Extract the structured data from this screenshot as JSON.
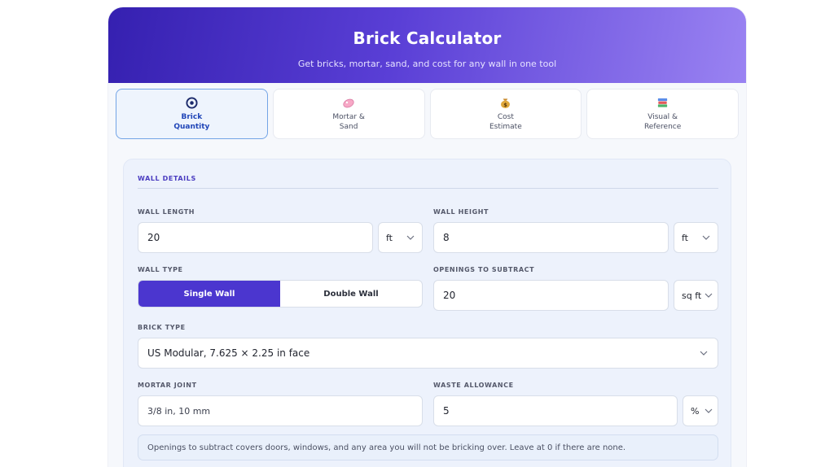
{
  "header": {
    "title": "Brick Calculator",
    "subtitle": "Get bricks, mortar, sand, and cost for any wall in one tool"
  },
  "tabs": [
    {
      "label": "Brick\nQuantity",
      "icon": "target-icon",
      "active": true
    },
    {
      "label": "Mortar &\nSand",
      "icon": "soap-icon",
      "active": false
    },
    {
      "label": "Cost\nEstimate",
      "icon": "money-bag-icon",
      "active": false
    },
    {
      "label": "Visual &\nReference",
      "icon": "books-icon",
      "active": false
    }
  ],
  "wall_details": {
    "section_title": "WALL DETAILS",
    "wall_length": {
      "label": "WALL LENGTH",
      "value": "20",
      "unit": "ft"
    },
    "wall_height": {
      "label": "WALL HEIGHT",
      "value": "8",
      "unit": "ft"
    },
    "wall_type": {
      "label": "WALL TYPE",
      "options": [
        "Single Wall",
        "Double Wall"
      ],
      "selected": "Single Wall"
    },
    "openings": {
      "label": "OPENINGS TO SUBTRACT",
      "value": "20",
      "unit": "sq ft"
    },
    "brick_type": {
      "label": "BRICK TYPE",
      "value": "US Modular, 7.625 × 2.25 in face"
    },
    "mortar_joint": {
      "label": "MORTAR JOINT",
      "value": "3/8 in, 10 mm"
    },
    "waste": {
      "label": "WASTE ALLOWANCE",
      "value": "5",
      "unit": "%"
    },
    "note": "Openings to subtract covers doors, windows, and any area you will not be bricking over. Leave at 0 if there are none."
  },
  "colors": {
    "accent": "#4b36cf",
    "header_start": "#3520b0",
    "header_end": "#9a83f2",
    "active_tab_border": "#73a4e6"
  }
}
